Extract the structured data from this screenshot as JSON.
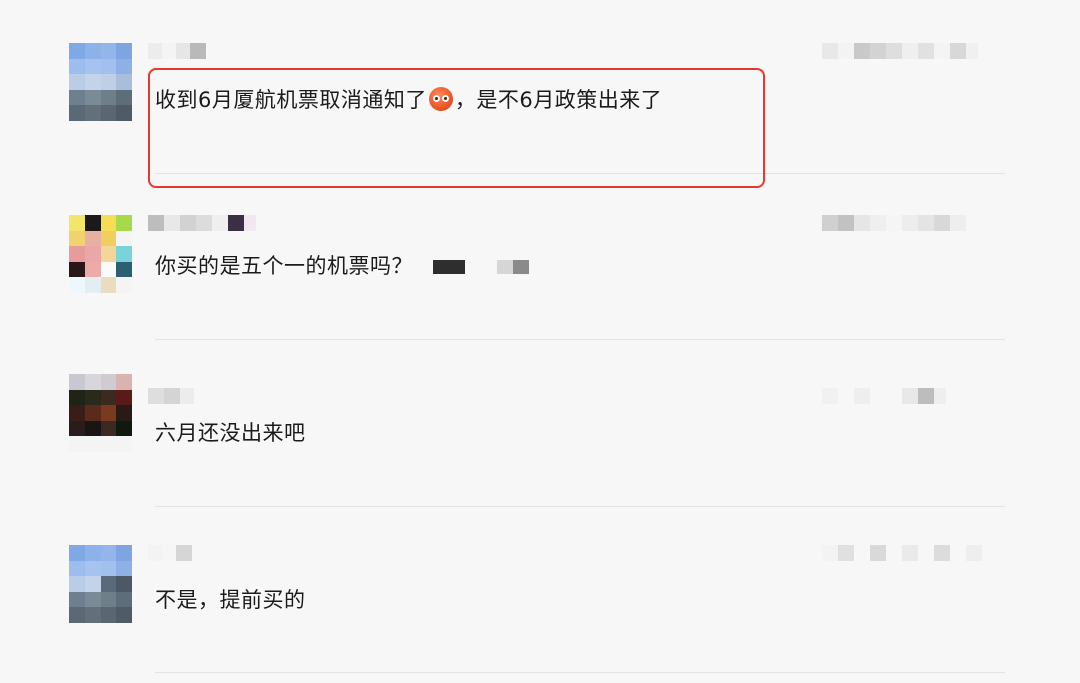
{
  "messages": [
    {
      "text_before_emoji": "收到6月厦航机票取消通知了",
      "text_after_emoji": "，是不6月政策出来了",
      "emoji_icon": "flushed-face-emoji",
      "highlighted": true,
      "highlight_color": "#e9372d"
    },
    {
      "text": "你买的是五个一的机票吗？",
      "highlighted": false
    },
    {
      "text": "六月还没出来吧",
      "highlighted": false
    },
    {
      "text": "不是，提前买的",
      "highlighted": false
    }
  ]
}
